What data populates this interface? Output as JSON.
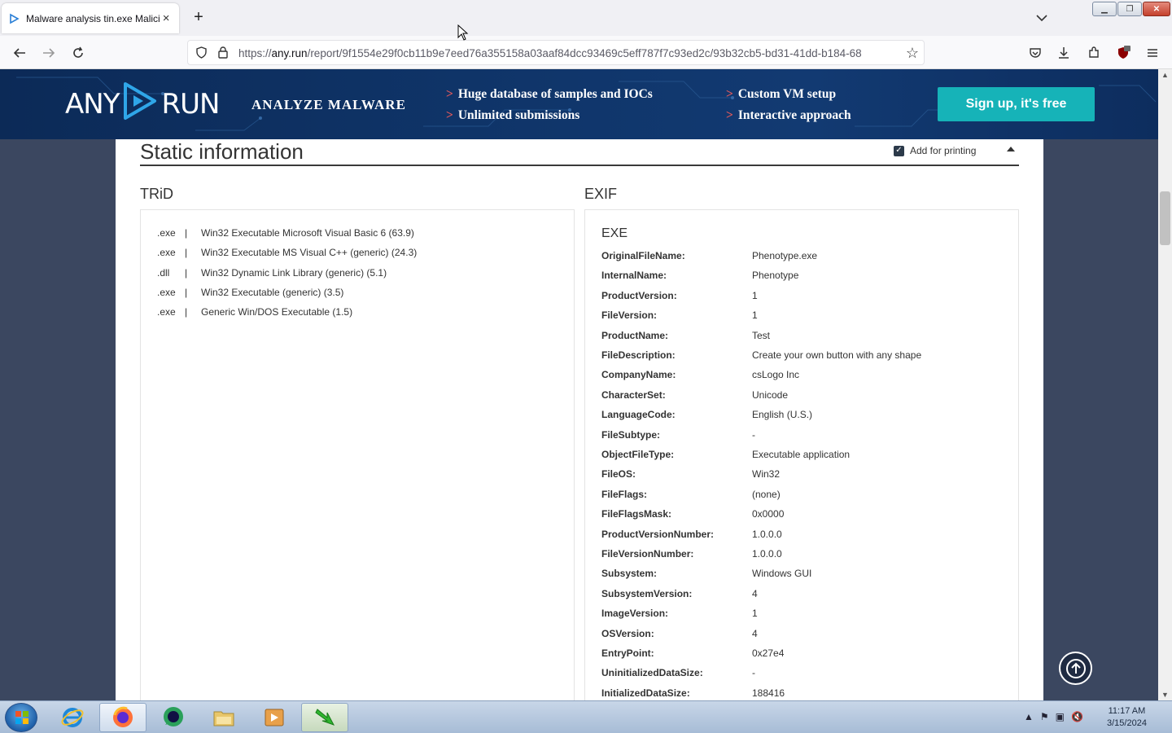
{
  "browser": {
    "tab_title": "Malware analysis tin.exe Malicious",
    "url_prefix": "https://",
    "url_domain": "any.run",
    "url_path": "/report/9f1554e29f0cb11b9e7eed76a355158a03aaf84dcc93469c5eff787f7c93ed2c/93b32cb5-bd31-41dd-b184-68"
  },
  "banner": {
    "logo_left": "ANY",
    "logo_right": "RUN",
    "analyze": "ANALYZE MALWARE",
    "features": [
      "Huge database of samples and IOCs",
      "Unlimited submissions",
      "Custom VM setup",
      "Interactive approach"
    ],
    "feature_marker": ">",
    "signup": "Sign up, it's free"
  },
  "static_info": {
    "title": "Static information",
    "add_for_printing": "Add for printing"
  },
  "trid": {
    "heading": "TRiD",
    "separator": "|",
    "rows": [
      {
        "ext": ".exe",
        "desc": "Win32 Executable Microsoft Visual Basic 6 (63.9)"
      },
      {
        "ext": ".exe",
        "desc": "Win32 Executable MS Visual C++ (generic) (24.3)"
      },
      {
        "ext": ".dll",
        "desc": "Win32 Dynamic Link Library (generic) (5.1)"
      },
      {
        "ext": ".exe",
        "desc": "Win32 Executable (generic) (3.5)"
      },
      {
        "ext": ".exe",
        "desc": "Generic Win/DOS Executable (1.5)"
      }
    ]
  },
  "exif": {
    "heading": "EXIF",
    "subheading": "EXE",
    "rows": [
      {
        "key": "OriginalFileName:",
        "value": "Phenotype.exe"
      },
      {
        "key": "InternalName:",
        "value": "Phenotype"
      },
      {
        "key": "ProductVersion:",
        "value": "1"
      },
      {
        "key": "FileVersion:",
        "value": "1"
      },
      {
        "key": "ProductName:",
        "value": "Test"
      },
      {
        "key": "FileDescription:",
        "value": "Create your own button with any shape"
      },
      {
        "key": "CompanyName:",
        "value": "csLogo Inc"
      },
      {
        "key": "CharacterSet:",
        "value": "Unicode"
      },
      {
        "key": "LanguageCode:",
        "value": "English (U.S.)"
      },
      {
        "key": "FileSubtype:",
        "value": "-"
      },
      {
        "key": "ObjectFileType:",
        "value": "Executable application"
      },
      {
        "key": "FileOS:",
        "value": "Win32"
      },
      {
        "key": "FileFlags:",
        "value": "(none)"
      },
      {
        "key": "FileFlagsMask:",
        "value": "0x0000"
      },
      {
        "key": "ProductVersionNumber:",
        "value": "1.0.0.0"
      },
      {
        "key": "FileVersionNumber:",
        "value": "1.0.0.0"
      },
      {
        "key": "Subsystem:",
        "value": "Windows GUI"
      },
      {
        "key": "SubsystemVersion:",
        "value": "4"
      },
      {
        "key": "ImageVersion:",
        "value": "1"
      },
      {
        "key": "OSVersion:",
        "value": "4"
      },
      {
        "key": "EntryPoint:",
        "value": "0x27e4"
      },
      {
        "key": "UninitializedDataSize:",
        "value": "-"
      },
      {
        "key": "InitializedDataSize:",
        "value": "188416"
      }
    ]
  },
  "taskbar": {
    "time": "11:17 AM",
    "date": "3/15/2024"
  },
  "colors": {
    "accent": "#16b3b8",
    "banner_bg": "#0f3468",
    "page_bg": "#3b4760",
    "feature_marker": "#e85a5a"
  }
}
